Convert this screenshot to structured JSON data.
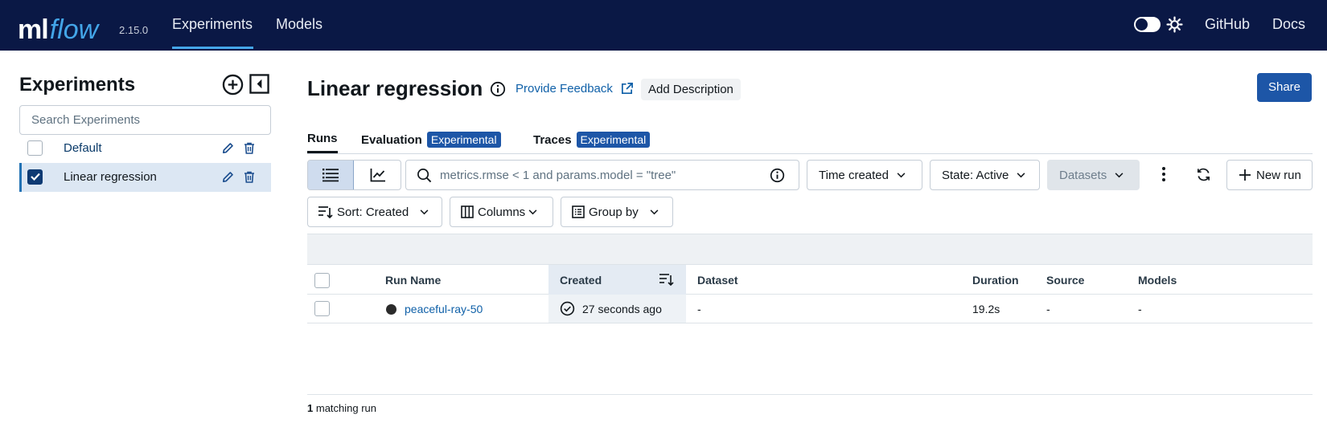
{
  "app": {
    "logo_ml": "ml",
    "logo_flow": "flow",
    "version": "2.15.0",
    "nav": {
      "experiments": "Experiments",
      "models": "Models",
      "github": "GitHub",
      "docs": "Docs"
    }
  },
  "sidebar": {
    "title": "Experiments",
    "search_placeholder": "Search Experiments",
    "items": [
      {
        "label": "Default",
        "checked": false,
        "selected": false
      },
      {
        "label": "Linear regression",
        "checked": true,
        "selected": true
      }
    ]
  },
  "header": {
    "title": "Linear regression",
    "feedback": "Provide Feedback",
    "add_description": "Add Description",
    "share": "Share"
  },
  "tabs": [
    {
      "label": "Runs",
      "badge": "",
      "active": true
    },
    {
      "label": "Evaluation",
      "badge": "Experimental",
      "active": false
    },
    {
      "label": "Traces",
      "badge": "Experimental",
      "active": false
    }
  ],
  "toolbar": {
    "search_placeholder": "metrics.rmse < 1 and params.model = \"tree\"",
    "time_created": "Time created",
    "state": "State: Active",
    "datasets": "Datasets",
    "new_run": "New run",
    "sort": "Sort: Created",
    "columns": "Columns",
    "group_by": "Group by"
  },
  "table": {
    "columns": [
      "Run Name",
      "Created",
      "Dataset",
      "Duration",
      "Source",
      "Models"
    ],
    "rows": [
      {
        "run_name": "peaceful-ray-50",
        "created": "27 seconds ago",
        "dataset": "-",
        "duration": "19.2s",
        "source": "-",
        "models": "-"
      }
    ],
    "footer_count": "1",
    "footer_label": "matching run"
  },
  "colors": {
    "topbar": "#0a1845",
    "accent": "#43a5e8",
    "primary_button": "#1d56a7",
    "link": "#0f60a8",
    "selected_row": "#dce7f3"
  },
  "icons": [
    "gear-icon",
    "add-circle-icon",
    "collapse-sidebar-icon",
    "pencil-icon",
    "trash-icon",
    "info-icon",
    "external-link-icon",
    "list-view-icon",
    "chart-view-icon",
    "search-icon",
    "chevron-down-icon",
    "kebab-menu-icon",
    "refresh-icon",
    "plus-icon",
    "sort-icon",
    "columns-icon",
    "group-by-icon",
    "check-circle-icon"
  ]
}
